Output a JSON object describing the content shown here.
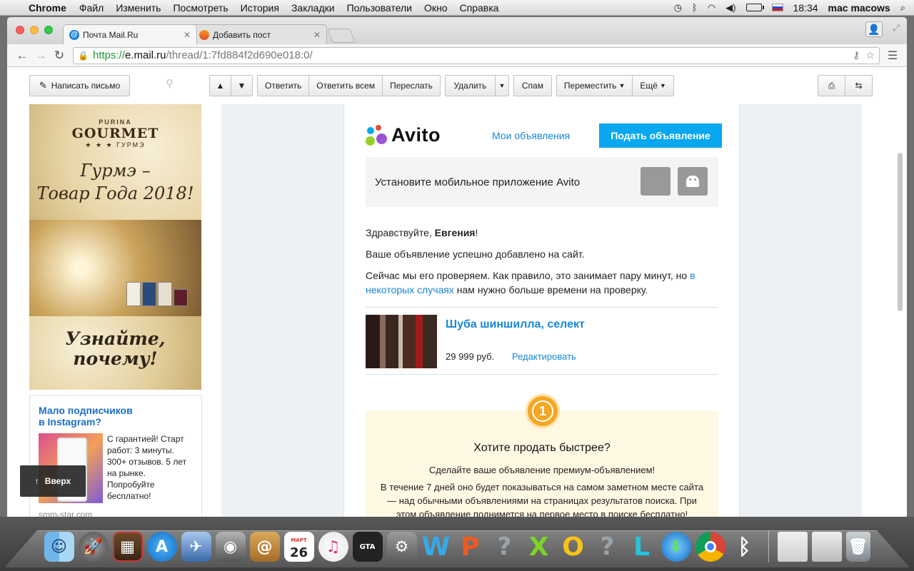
{
  "menubar": {
    "app": "Chrome",
    "items": [
      "Файл",
      "Изменить",
      "Посмотреть",
      "История",
      "Закладки",
      "Пользователи",
      "Окно",
      "Справка"
    ],
    "time": "18:34",
    "user": "mac macows"
  },
  "tabs": [
    {
      "title": "Почта Mail.Ru",
      "favicon": "mailru-icon",
      "active": true
    },
    {
      "title": "Добавить пост",
      "favicon": "odnoklassniki-icon",
      "active": false
    }
  ],
  "address": {
    "scheme": "https://",
    "host": "e.mail.ru",
    "path": "/thread/1:7fd884f2d690e018:0/"
  },
  "mail_toolbar": {
    "compose": "Написать письмо",
    "reply": "Ответить",
    "reply_all": "Ответить всем",
    "forward": "Переслать",
    "delete": "Удалить",
    "spam": "Спам",
    "move": "Переместить",
    "more": "Ещё"
  },
  "ad": {
    "brand_small": "PURINA",
    "brand": "GOURMET",
    "brand_ru": "★ ★ ★  ГУРМЭ",
    "slogan_1": "Гурмэ –",
    "slogan_2": "Товар Года 2018!",
    "cta_1": "Узнайте,",
    "cta_2": "почему!"
  },
  "promo": {
    "title_1": "Мало подписчиков",
    "title_2": "в Instagram?",
    "text": "С гарантией! Старт работ: 3 минуты. 300+ отзывов. 5 лет на рынке. Попробуйте бесплатно!",
    "site": "smm-star.com"
  },
  "scroll_top": "Вверх",
  "letter": {
    "logo": "Avito",
    "my_ads": "Мои объявления",
    "post_ad": "Подать объявление",
    "app_banner": "Установите мобильное приложение Avito",
    "greeting_prefix": "Здравствуйте, ",
    "greeting_name": "Евгения",
    "greeting_suffix": "!",
    "added": "Ваше объявление успешно добавлено на сайт.",
    "check_prefix": "Сейчас мы его проверяем. Как правило, это занимает пару минут, но ",
    "check_link": "в некоторых случаях",
    "check_suffix": " нам нужно больше времени на проверку.",
    "item_title": "Шуба шиншилла, селект",
    "item_price": "29 999 руб.",
    "item_edit": "Редактировать",
    "premium_badge": "1",
    "premium_title": "Хотите продать быстрее?",
    "premium_sub": "Сделайте ваше объявление премиум-объявлением!",
    "premium_desc": "В течение 7 дней оно будет показываться на самом заметном месте сайта — над обычными объявлениями на страницах результатов поиска. При этом объявление поднимется на первое место в поиске бесплатно!"
  },
  "dock": {
    "calendar_month": "МАРТ",
    "calendar_day": "26",
    "items": [
      "finder-icon",
      "launchpad-icon",
      "photo-booth-icon",
      "app-store-icon",
      "preview-icon",
      "facetime-icon",
      "contacts-icon",
      "calendar-icon",
      "itunes-icon",
      "gta-icon",
      "system-preferences-icon",
      "word-icon",
      "powerpoint-icon",
      "unknown-app-icon",
      "excel-icon",
      "outlook-icon",
      "unknown-app-icon",
      "lync-icon",
      "downloads-globe-icon",
      "chrome-icon",
      "bluetooth-icon",
      "document-stack-icon",
      "recent-apps-stack-icon",
      "trash-icon"
    ]
  }
}
